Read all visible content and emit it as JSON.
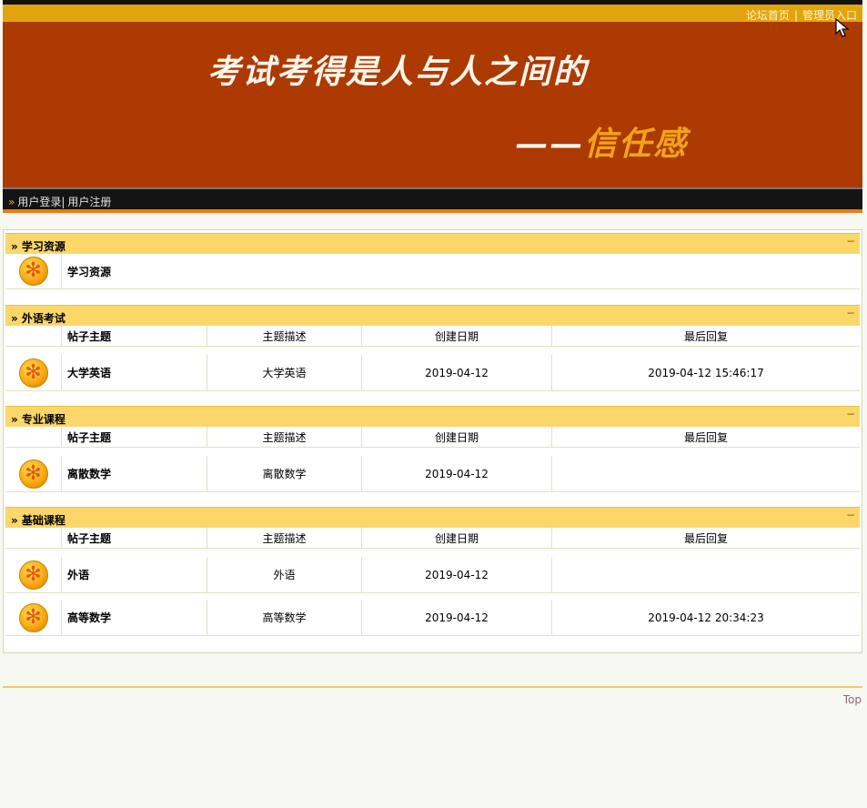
{
  "header": {
    "links": {
      "forum_home": "论坛首页",
      "separator": "|",
      "admin_entry": "管理员入口"
    },
    "slogan_line1": "考试考得是人与人之间的",
    "slogan_dash": "——",
    "slogan_line2": "信任感",
    "nav": {
      "raquo": "»",
      "login": "用户登录",
      "separator": "|",
      "register": "用户注册"
    }
  },
  "columns": {
    "topic": "帖子主题",
    "desc": "主题描述",
    "date": "创建日期",
    "last": "最后回复"
  },
  "sections": [
    {
      "title": "» 学习资源",
      "collapse": "−",
      "rows": [
        {
          "topic": "学习资源"
        }
      ]
    },
    {
      "title": "» 外语考试",
      "collapse": "−",
      "rows": [
        {
          "topic": "大学英语",
          "desc": "大学英语",
          "date": "2019-04-12",
          "last": "2019-04-12 15:46:17"
        }
      ]
    },
    {
      "title": "» 专业课程",
      "collapse": "−",
      "rows": [
        {
          "topic": "离散数学",
          "desc": "离散数学",
          "date": "2019-04-12",
          "last": ""
        }
      ]
    },
    {
      "title": "» 基础课程",
      "collapse": "−",
      "rows": [
        {
          "topic": "外语",
          "desc": "外语",
          "date": "2019-04-12",
          "last": ""
        },
        {
          "topic": "高等数学",
          "desc": "高等数学",
          "date": "2019-04-12",
          "last": "2019-04-12 20:34:23"
        }
      ]
    }
  ],
  "footer": {
    "top_link": "Top"
  },
  "icons": {
    "forum": "forum-star-icon",
    "cursor": "mouse-pointer-icon"
  },
  "colors": {
    "banner": "#ac3a02",
    "topbar": "#e2a40d",
    "section_head": "#fbd76a",
    "accent": "#f2a21a"
  }
}
